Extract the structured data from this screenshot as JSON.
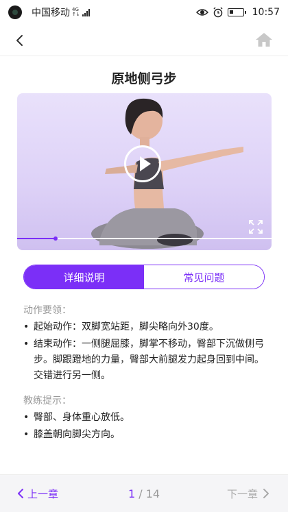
{
  "status_bar": {
    "carrier": "中国移动",
    "network_top": "4G",
    "network_bottom": "↑↓",
    "time": "10:57"
  },
  "nav": {
    "back_icon": "chevron-left-icon",
    "home_icon": "home-icon"
  },
  "page_title": "原地侧弓步",
  "video": {
    "progress": 0.15,
    "accent_color": "#7b2ff7"
  },
  "tabs": [
    {
      "label": "详细说明",
      "active": true
    },
    {
      "label": "常见问题",
      "active": false
    }
  ],
  "sections": {
    "key_points_title": "动作要领：",
    "key_points": [
      "起始动作：双脚宽站距，脚尖略向外30度。",
      "结束动作：一侧腿屈膝，脚掌不移动，臀部下沉做侧弓步。脚跟蹬地的力量，臀部大前腿发力起身回到中间。交错进行另一侧。"
    ],
    "coach_tips_title": "教练提示：",
    "coach_tips": [
      "臀部、身体重心放低。",
      "膝盖朝向脚尖方向。"
    ]
  },
  "pager": {
    "prev_label": "上一章",
    "current": "1",
    "total": "/ 14",
    "next_label": "下一章"
  }
}
